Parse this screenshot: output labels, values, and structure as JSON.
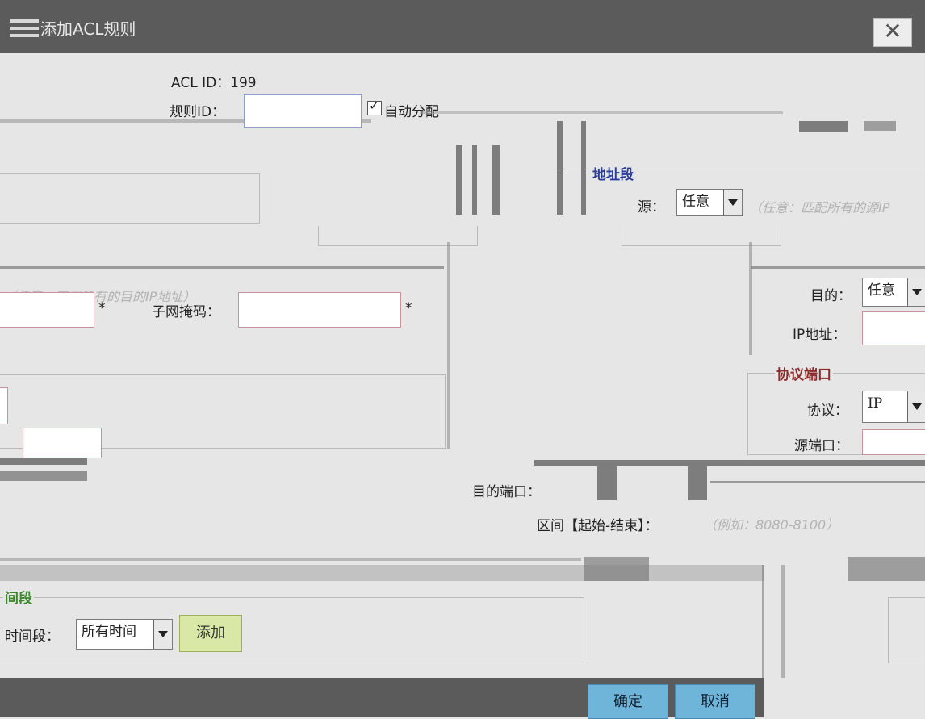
{
  "dialog": {
    "title": "添加ACL规则",
    "close_glyph": "✕"
  },
  "acl": {
    "id_label": "ACL ID：199",
    "rule_id_label": "规则ID：",
    "auto_assign_label": "自动分配"
  },
  "address": {
    "legend": "地址段",
    "source_label": "源：",
    "source_value": "任意",
    "source_hint": "（任意：匹配所有的源IP",
    "dest_hint": "（任意：匹配所有的目的IP地址）",
    "dest_label": "目的：",
    "dest_value": "任意",
    "ip_label": "IP地址：",
    "mask_label": "子网掩码：",
    "required_mark": "*"
  },
  "protocol": {
    "legend": "协议端口",
    "protocol_label": "协议：",
    "protocol_value": "IP",
    "src_port_label": "源端口："
  },
  "dest_port": {
    "label": "目的端口：",
    "range_label": "区间【起始-结束】：",
    "range_hint": "（例如：8080-8100）"
  },
  "time": {
    "legend": "间段",
    "label": "时间段：",
    "value": "所有时间",
    "add_label": "添加"
  },
  "footer": {
    "ok_label": "确定",
    "cancel_label": "取消"
  }
}
